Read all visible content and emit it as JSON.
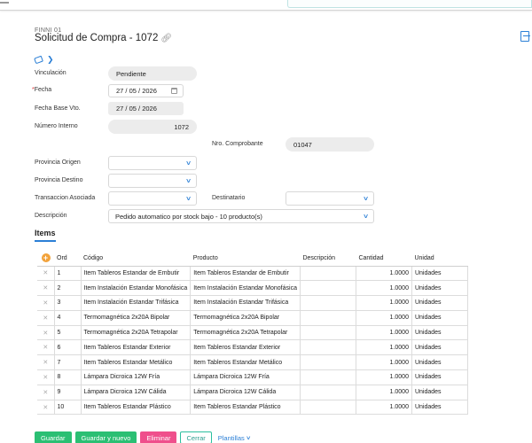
{
  "document": {
    "code": "FINNI 01",
    "title": "Solicitud de Compra - 1072"
  },
  "form": {
    "vinculacion": {
      "label": "Vinculación",
      "value": "Pendiente"
    },
    "fecha": {
      "label": "Fecha",
      "required_mark": "*",
      "day": "27",
      "month": "05",
      "year": "2026"
    },
    "fecha_base": {
      "label": "Fecha Base Vto.",
      "day": "27",
      "month": "05",
      "year": "2026"
    },
    "numero_interno": {
      "label": "Número Interno",
      "value": "1072"
    },
    "nro_comprobante": {
      "label": "Nro. Comprobante",
      "value": "01047"
    },
    "provincia_origen": {
      "label": "Provincia Origen",
      "value": ""
    },
    "provincia_destino": {
      "label": "Provincia Destino",
      "value": ""
    },
    "transaccion": {
      "label": "Transaccion Asociada",
      "value": ""
    },
    "destinatario": {
      "label": "Destinatario",
      "value": ""
    },
    "descripcion": {
      "label": "Descripción",
      "value": "Pedido automatico por stock bajo - 10 producto(s)"
    }
  },
  "tabs": {
    "items": "Items"
  },
  "grid": {
    "headers": {
      "ord": "Ord",
      "codigo": "Código",
      "producto": "Producto",
      "descripcion": "Descripción",
      "cantidad": "Cantidad",
      "unidad": "Unidad"
    },
    "rows": [
      {
        "ord": "1",
        "codigo": "Item Tableros Estandar de Embutir",
        "producto": "Item Tableros Estandar de Embutir",
        "descripcion": "",
        "cantidad": "1.0000",
        "unidad": "Unidades"
      },
      {
        "ord": "2",
        "codigo": "Item Instalación Estandar Monofásica",
        "producto": "Item Instalación Estandar Monofásica",
        "descripcion": "",
        "cantidad": "1.0000",
        "unidad": "Unidades"
      },
      {
        "ord": "3",
        "codigo": "Item Instalación Estandar Trifásica",
        "producto": "Item Instalación Estandar Trifásica",
        "descripcion": "",
        "cantidad": "1.0000",
        "unidad": "Unidades"
      },
      {
        "ord": "4",
        "codigo": "Termomagnética 2x20A Bipolar",
        "producto": "Termomagnética 2x20A Bipolar",
        "descripcion": "",
        "cantidad": "1.0000",
        "unidad": "Unidades"
      },
      {
        "ord": "5",
        "codigo": "Termomagnética 2x20A Tetrapolar",
        "producto": "Termomagnética 2x20A Tetrapolar",
        "descripcion": "",
        "cantidad": "1.0000",
        "unidad": "Unidades"
      },
      {
        "ord": "6",
        "codigo": "Item Tableros Estandar Exterior",
        "producto": "Item Tableros Estandar Exterior",
        "descripcion": "",
        "cantidad": "1.0000",
        "unidad": "Unidades"
      },
      {
        "ord": "7",
        "codigo": "Item Tableros Estandar Metálico",
        "producto": "Item Tableros Estandar Metálico",
        "descripcion": "",
        "cantidad": "1.0000",
        "unidad": "Unidades"
      },
      {
        "ord": "8",
        "codigo": "Lámpara Dicroica 12W Fría",
        "producto": "Lámpara Dicroica 12W Fría",
        "descripcion": "",
        "cantidad": "1.0000",
        "unidad": "Unidades"
      },
      {
        "ord": "9",
        "codigo": "Lámpara Dicroica 12W Cálida",
        "producto": "Lámpara Dicroica 12W Cálida",
        "descripcion": "",
        "cantidad": "1.0000",
        "unidad": "Unidades"
      },
      {
        "ord": "10",
        "codigo": "Item Tableros Estandar Plástico",
        "producto": "Item Tableros Estandar Plástico",
        "descripcion": "",
        "cantidad": "1.0000",
        "unidad": "Unidades"
      }
    ]
  },
  "buttons": {
    "guardar": "Guardar",
    "guardar_nuevo": "Guardar y nuevo",
    "eliminar": "Eliminar",
    "cerrar": "Cerrar",
    "plantillas": "Plantillas"
  },
  "colors": {
    "accent": "#2b7fd6",
    "save": "#2bbf73",
    "delete": "#ef4f8c",
    "add": "#f2a23a"
  }
}
